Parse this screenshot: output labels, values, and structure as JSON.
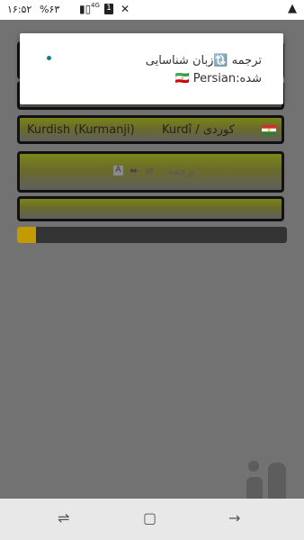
{
  "status_bar": {
    "time": "۱۶:۵۲",
    "battery": "%۶۳",
    "network": "4G",
    "sim": "1"
  },
  "toast": {
    "line1": "ترجمه 🔃زبان شناسایی",
    "line2": "شده:🇮🇷 Persian"
  },
  "language_row": {
    "left": "Kurdish (Kurmanji)",
    "right": "Kurdî / کوردی"
  },
  "translate_button": {
    "label": "ترجمه",
    "arrows": "⇄",
    "chars": "⬌"
  },
  "progress": {
    "fraction": 0.07
  },
  "colors": {
    "accent_olive": "#7a8419",
    "progress_fill": "#c39a00"
  },
  "icons": {
    "warn": "warning-icon",
    "mute": "mute-icon"
  }
}
